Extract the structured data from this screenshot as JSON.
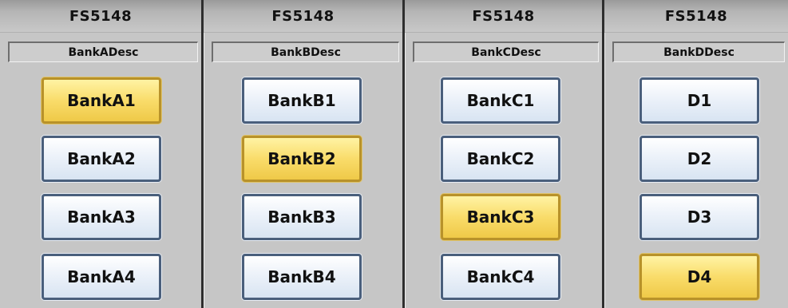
{
  "banks": [
    {
      "title": "FS5148",
      "description": "BankADesc",
      "presets": [
        {
          "label": "BankA1",
          "active": true
        },
        {
          "label": "BankA2",
          "active": false
        },
        {
          "label": "BankA3",
          "active": false
        },
        {
          "label": "BankA4",
          "active": false
        }
      ]
    },
    {
      "title": "FS5148",
      "description": "BankBDesc",
      "presets": [
        {
          "label": "BankB1",
          "active": false
        },
        {
          "label": "BankB2",
          "active": true
        },
        {
          "label": "BankB3",
          "active": false
        },
        {
          "label": "BankB4",
          "active": false
        }
      ]
    },
    {
      "title": "FS5148",
      "description": "BankCDesc",
      "presets": [
        {
          "label": "BankC1",
          "active": false
        },
        {
          "label": "BankC2",
          "active": false
        },
        {
          "label": "BankC3",
          "active": true
        },
        {
          "label": "BankC4",
          "active": false
        }
      ]
    },
    {
      "title": "FS5148",
      "description": "BankDDesc",
      "presets": [
        {
          "label": "D1",
          "active": false
        },
        {
          "label": "D2",
          "active": false
        },
        {
          "label": "D3",
          "active": false
        },
        {
          "label": "D4",
          "active": true
        }
      ]
    }
  ],
  "colors": {
    "active_fill": "#f9dc6a",
    "active_border": "#b8922a",
    "inactive_fill": "#eef3fa",
    "inactive_border": "#4a5f7c",
    "panel_bg": "#c6c6c6",
    "divider": "#2e2e2e"
  }
}
